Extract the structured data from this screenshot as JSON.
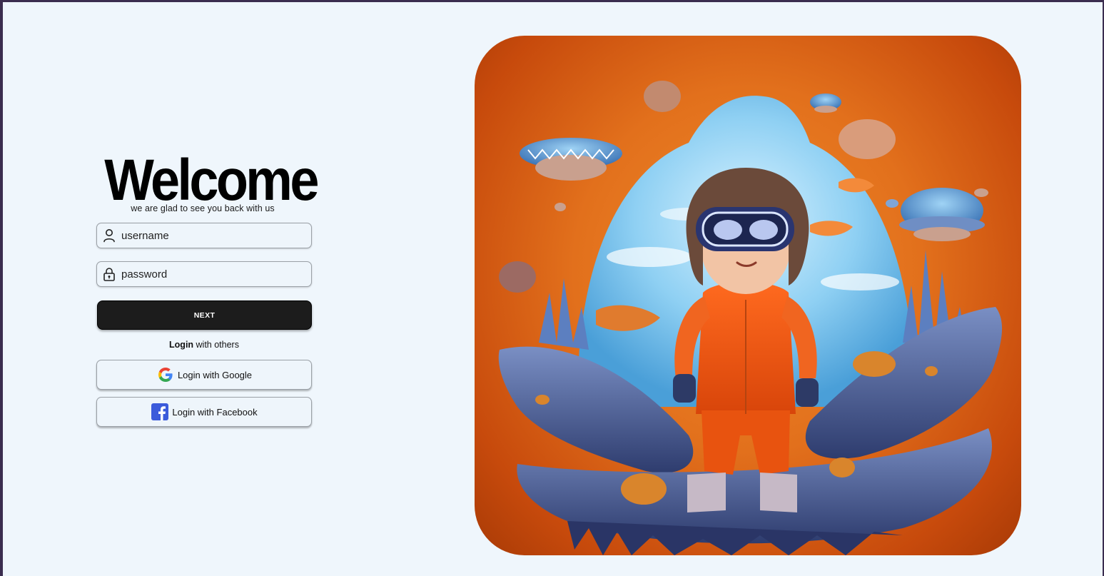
{
  "login": {
    "title": "Welcome",
    "subtitle": "we are glad to see you back with us",
    "username_placeholder": "username",
    "password_placeholder": "password",
    "next_label": "NEXT",
    "others_bold": "Login",
    "others_rest": " with others",
    "google_label": "Login with Google",
    "facebook_label": "Login with Facebook"
  },
  "icons": {
    "user": "user-icon",
    "lock": "lock-icon",
    "google": "google-logo-icon",
    "facebook": "facebook-logo-icon"
  },
  "colors": {
    "page_bg": "#eff6fc",
    "button_dark": "#1c1c1c",
    "hero_orange": "#e2701c",
    "facebook_blue": "#3b5bdb"
  },
  "hero": {
    "description_alt": "illustration"
  }
}
